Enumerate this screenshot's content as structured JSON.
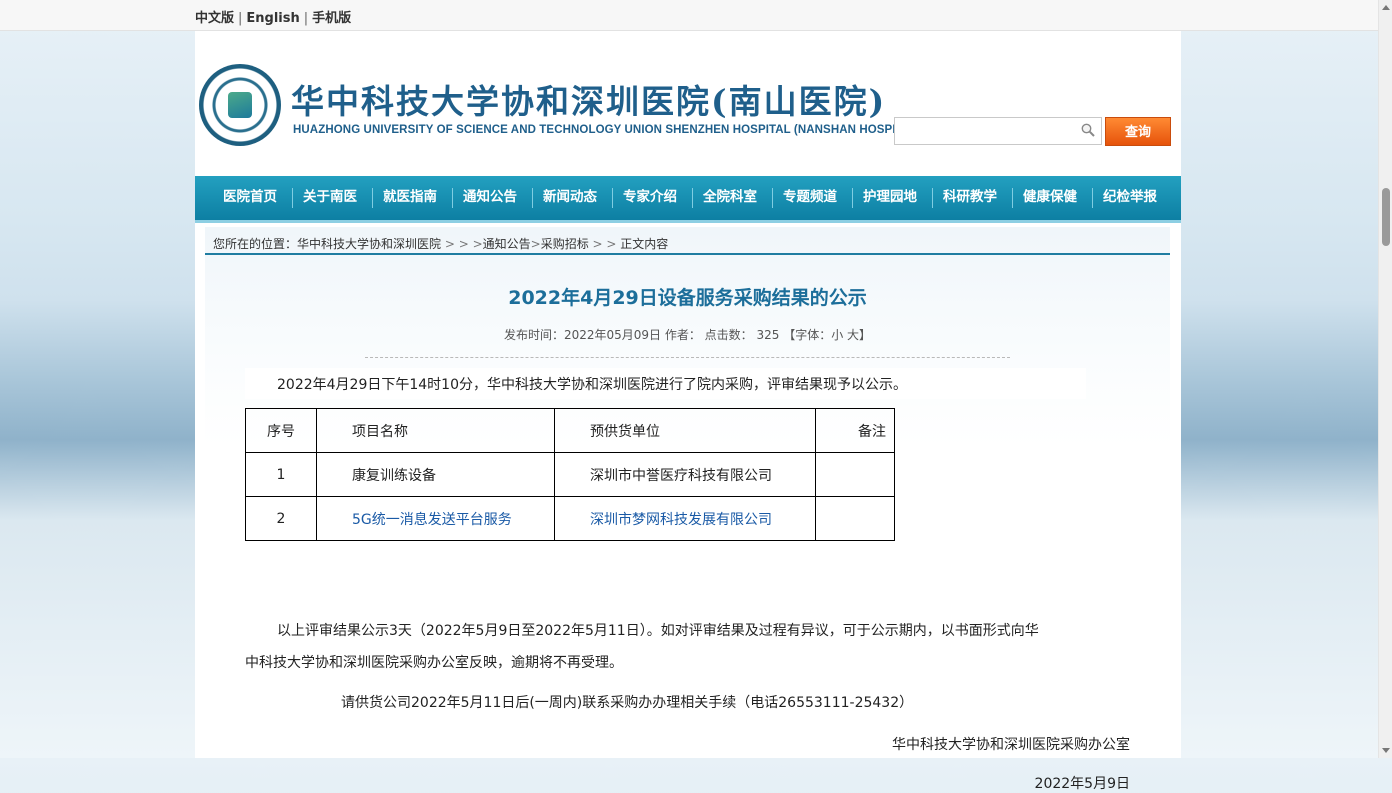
{
  "toplinks": {
    "cn": "中文版",
    "sep": "|",
    "en": "English",
    "mobile": "手机版"
  },
  "header": {
    "cn_title": "华中科技大学协和深圳医院(南山医院)",
    "en_title": "HUAZHONG UNIVERSITY OF SCIENCE AND TECHNOLOGY UNION SHENZHEN HOSPITAL (NANSHAN HOSPITAL)",
    "search_value": "",
    "search_button": "查询"
  },
  "nav": {
    "items": [
      "医院首页",
      "关于南医",
      "就医指南",
      "通知公告",
      "新闻动态",
      "专家介绍",
      "全院科室",
      "专题频道",
      "护理园地",
      "科研教学",
      "健康保健",
      "纪检举报"
    ]
  },
  "breadcrumb": {
    "prefix": "您所在的位置：",
    "home": "华中科技大学协和深圳医院",
    "sep1": " > > >",
    "notice": "通知公告",
    "sep2": ">",
    "procure": "采购招标",
    "sep3": " > > ",
    "current": "正文内容"
  },
  "article": {
    "title": "2022年4月29日设备服务采购结果的公示",
    "meta": "发布时间：2022年05月09日  作者：  点击数：  325  【字体：小 大】",
    "intro": "2022年4月29日下午14时10分，华中科技大学协和深圳医院进行了院内采购，评审结果现予以公示。",
    "table": {
      "headers": [
        "序号",
        "项目名称",
        "预供货单位",
        "备注"
      ],
      "rows": [
        [
          "1",
          "康复训练设备",
          "深圳市中誉医疗科技有限公司",
          ""
        ],
        [
          "2",
          "5G统一消息发送平台服务",
          "深圳市梦网科技发展有限公司",
          ""
        ]
      ]
    },
    "para2_line1": "以上评审结果公示3天（2022年5月9日至2022年5月11日）。如对评审结果及过程有异议，可于公示期内，以书面形式向华",
    "para2_line2": "中科技大学协和深圳医院采购办公室反映，逾期将不再受理。",
    "para3": "请供货公司2022年5月11日后(一周内)联系采购办办理相关手续（电话26553111-25432）",
    "sign": "华中科技大学协和深圳医院采购办公室",
    "date": "2022年5月9日"
  },
  "colors": {
    "nav": "#0d7fa3",
    "title": "#1c6e9a",
    "search_button": "#f0661a",
    "link": "#1a5aa6"
  }
}
